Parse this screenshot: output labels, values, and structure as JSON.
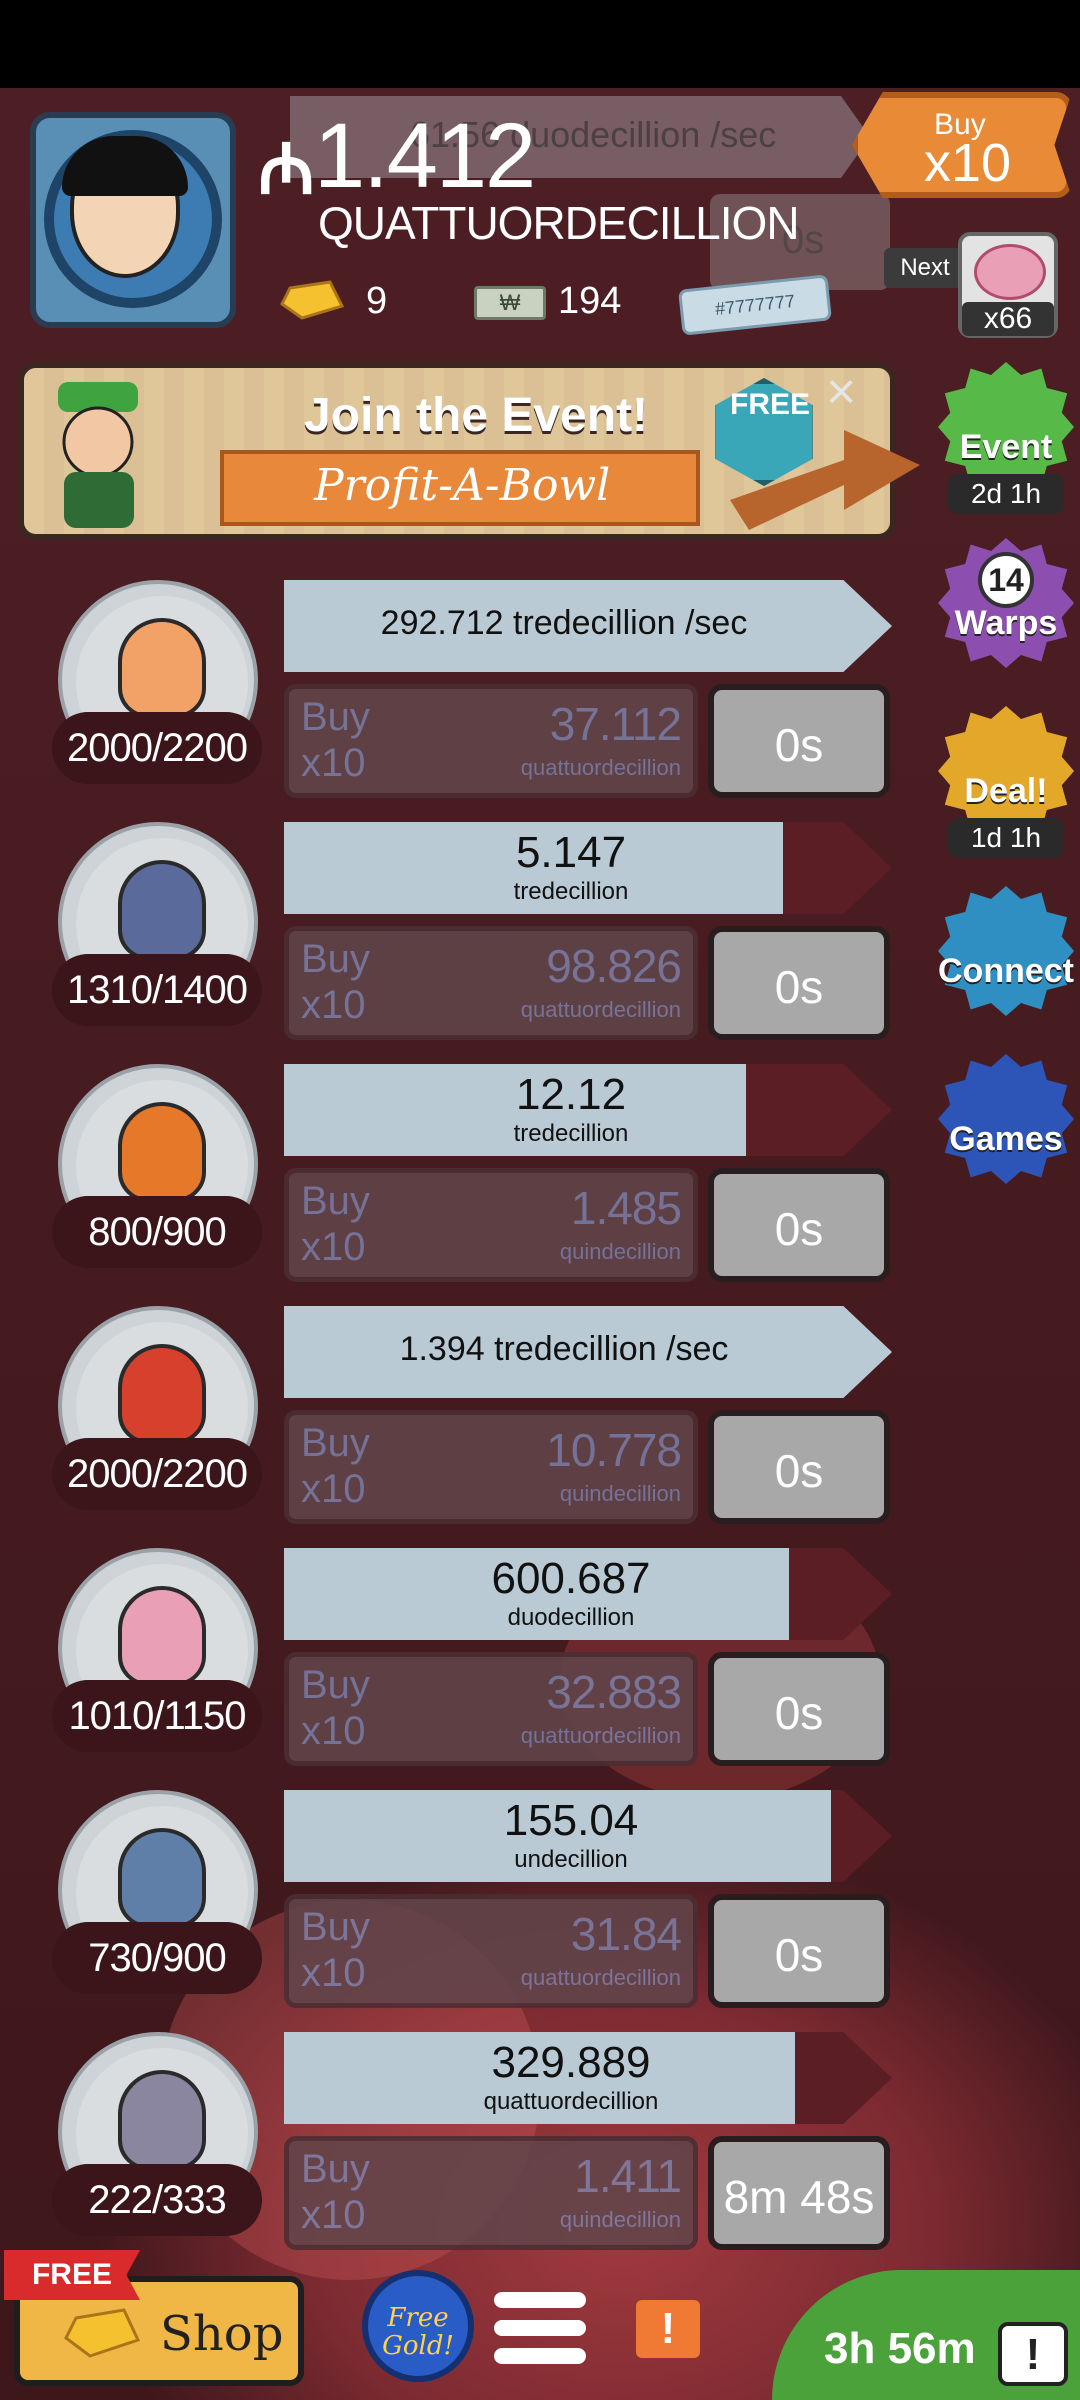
{
  "header": {
    "currency_symbol": "₼",
    "money_amount": "1.412",
    "money_unit": "QUATTUORDECILLION",
    "ghost_rate": "61.56 duodecillion /sec",
    "ghost_timer": "0s",
    "gold_count": "9",
    "megabucks_count": "194",
    "ticket_text": "#7777777",
    "buy_mult_small": "Buy",
    "buy_mult_big": "x10",
    "next_label": "Next",
    "next_mult": "x66"
  },
  "event": {
    "title": "Join the Event!",
    "subtitle": "Profit-A-Bowl",
    "free_label": "FREE",
    "close": "×"
  },
  "sidebar": [
    {
      "label": "Event",
      "sub": "2d 1h",
      "color": "#56b948"
    },
    {
      "label": "Warps",
      "badge": "14",
      "color": "#8c4fb0"
    },
    {
      "label": "Deal!",
      "sub": "1d 1h",
      "color": "#e3a82a"
    },
    {
      "label": "Connect",
      "color": "#2f8fc2"
    },
    {
      "label": "Games",
      "color": "#2d55b8"
    }
  ],
  "managers": [
    {
      "count": "2000/2200",
      "rate_text": "292.712 tredecillion /sec",
      "rate_mode": "sec",
      "fill": 1.0,
      "buy1": "Buy",
      "buy2": "x10",
      "cost": "37.112",
      "cost_unit": "quattuordecillion",
      "timer": "0s",
      "portrait_color": "#f2a267"
    },
    {
      "count": "1310/1400",
      "rate_big": "5.147",
      "rate_unit": "tredecillion",
      "rate_mode": "big",
      "fill": 0.82,
      "buy1": "Buy",
      "buy2": "x10",
      "cost": "98.826",
      "cost_unit": "quattuordecillion",
      "timer": "0s",
      "portrait_color": "#5a6a9a"
    },
    {
      "count": "800/900",
      "rate_big": "12.12",
      "rate_unit": "tredecillion",
      "rate_mode": "big",
      "fill": 0.76,
      "buy1": "Buy",
      "buy2": "x10",
      "cost": "1.485",
      "cost_unit": "quindecillion",
      "timer": "0s",
      "portrait_color": "#e6782a"
    },
    {
      "count": "2000/2200",
      "rate_text": "1.394 tredecillion /sec",
      "rate_mode": "sec",
      "fill": 1.0,
      "buy1": "Buy",
      "buy2": "x10",
      "cost": "10.778",
      "cost_unit": "quindecillion",
      "timer": "0s",
      "portrait_color": "#d8402e"
    },
    {
      "count": "1010/1150",
      "rate_big": "600.687",
      "rate_unit": "duodecillion",
      "rate_mode": "big",
      "fill": 0.83,
      "buy1": "Buy",
      "buy2": "x10",
      "cost": "32.883",
      "cost_unit": "quattuordecillion",
      "timer": "0s",
      "portrait_color": "#e99fb5"
    },
    {
      "count": "730/900",
      "rate_big": "155.04",
      "rate_unit": "undecillion",
      "rate_mode": "big",
      "fill": 0.9,
      "buy1": "Buy",
      "buy2": "x10",
      "cost": "31.84",
      "cost_unit": "quattuordecillion",
      "timer": "0s",
      "portrait_color": "#5f7fa8"
    },
    {
      "count": "222/333",
      "rate_big": "329.889",
      "rate_unit": "quattuordecillion",
      "rate_mode": "big",
      "fill": 0.84,
      "buy1": "Buy",
      "buy2": "x10",
      "cost": "1.411",
      "cost_unit": "quindecillion",
      "timer": "8m 48s",
      "portrait_color": "#8b86a0"
    }
  ],
  "bottom": {
    "free_flag": "FREE",
    "shop_label": "Shop",
    "free_gold": "Free Gold!",
    "alert": "!",
    "timer": "3h 56m",
    "tv": "!"
  }
}
